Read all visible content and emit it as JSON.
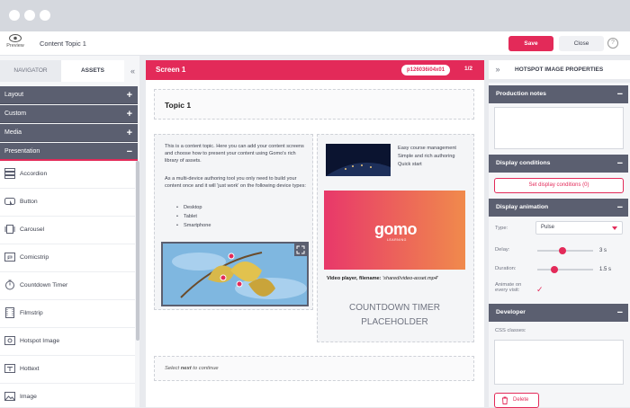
{
  "window": {
    "title": "Content Topic 1"
  },
  "topbar": {
    "preview_label": "Preview",
    "save_label": "Save",
    "close_label": "Close",
    "help_label": "?"
  },
  "left_panel": {
    "tabs": [
      {
        "label": "NAVIGATOR"
      },
      {
        "label": "ASSETS"
      }
    ],
    "collapse_glyph": "«",
    "categories": [
      {
        "label": "Layout",
        "toggle": "+"
      },
      {
        "label": "Custom",
        "toggle": "+"
      },
      {
        "label": "Media",
        "toggle": "+"
      },
      {
        "label": "Presentation",
        "toggle": "−"
      }
    ],
    "assets": [
      {
        "label": "Accordion",
        "icon": "accordion-icon"
      },
      {
        "label": "Button",
        "icon": "button-icon"
      },
      {
        "label": "Carousel",
        "icon": "carousel-icon"
      },
      {
        "label": "Comicstrip",
        "icon": "comicstrip-icon"
      },
      {
        "label": "Countdown Timer",
        "icon": "timer-icon"
      },
      {
        "label": "Filmstrip",
        "icon": "filmstrip-icon"
      },
      {
        "label": "Hotspot Image",
        "icon": "hotspot-image-icon"
      },
      {
        "label": "Hottext",
        "icon": "hottext-icon"
      },
      {
        "label": "Image",
        "icon": "image-icon"
      }
    ]
  },
  "screen": {
    "title": "Screen 1",
    "id": "p126036i04x01",
    "page": "1/2",
    "topic_title": "Topic 1",
    "intro_1": "This is a content topic. Here you can add your content screens and choose how to present your content using Gomo's rich library of assets.",
    "intro_2": "As a multi-device authoring tool you only need to build your content once and it will 'just work' on the following device types:",
    "devices": [
      "Desktop",
      "Tablet",
      "Smartphone"
    ],
    "media_lines": [
      "Easy course management",
      "Simple and rich authoring",
      "Quick start"
    ],
    "gomo_logo": "gomo",
    "gomo_sub": "LEARNING",
    "caption_label": "Video player, filename:",
    "caption_file": "'shared/video-asset.mp4'",
    "countdown_line1": "COUNTDOWN TIMER",
    "countdown_line2": "PLACEHOLDER",
    "next_prefix": "Select",
    "next_word": "next",
    "next_suffix": "to continue"
  },
  "right_panel": {
    "collapse_glyph": "»",
    "title": "HOTSPOT IMAGE PROPERTIES",
    "sections": {
      "production_notes": "Production notes",
      "display_conditions": "Display conditions",
      "display_animation": "Display animation",
      "developer": "Developer"
    },
    "set_conditions_label": "Set display conditions (0)",
    "type_label": "Type:",
    "type_value": "Pulse",
    "delay_label": "Delay:",
    "delay_value": "3 s",
    "delay_fraction": 0.45,
    "duration_label": "Duration:",
    "duration_value": "1.5 s",
    "duration_fraction": 0.28,
    "animate_label_1": "Animate on",
    "animate_label_2": "every visit:",
    "animate_checked": "✓",
    "css_classes_label": "CSS classes:",
    "delete_label": "Delete"
  },
  "colors": {
    "accent": "#e32a59",
    "panel_header": "#5b5f70"
  }
}
